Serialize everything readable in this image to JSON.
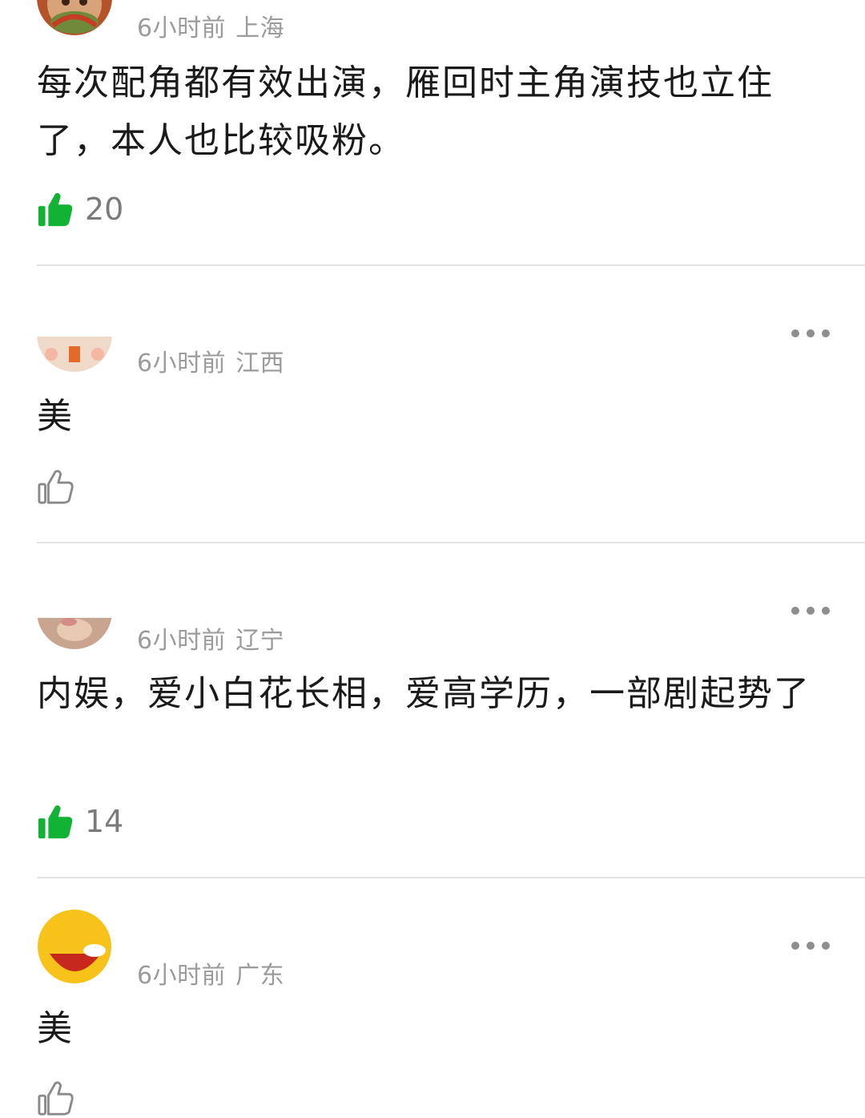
{
  "colors": {
    "like_active": "#12b335",
    "like_inactive": "#8a8a8a",
    "meta_text": "#9b9b9b",
    "divider": "#e3e3e3"
  },
  "comments": [
    {
      "time": "6小时前",
      "location": "上海",
      "text": "每次配角都有效出演，雁回时主角演技也立住了，本人也比较吸粉。",
      "likes": "20",
      "liked": true,
      "more_icon": "more-dots-icon"
    },
    {
      "time": "6小时前",
      "location": "江西",
      "text": "美",
      "likes": "",
      "liked": false,
      "more_icon": "more-dots-icon"
    },
    {
      "time": "6小时前",
      "location": "辽宁",
      "text": "内娱，爱小白花长相，爱高学历，一部剧起势了",
      "likes": "14",
      "liked": true,
      "more_icon": "more-dots-icon"
    },
    {
      "time": "6小时前",
      "location": "广东",
      "text": "美",
      "likes": "",
      "liked": false,
      "more_icon": "more-dots-icon"
    }
  ]
}
